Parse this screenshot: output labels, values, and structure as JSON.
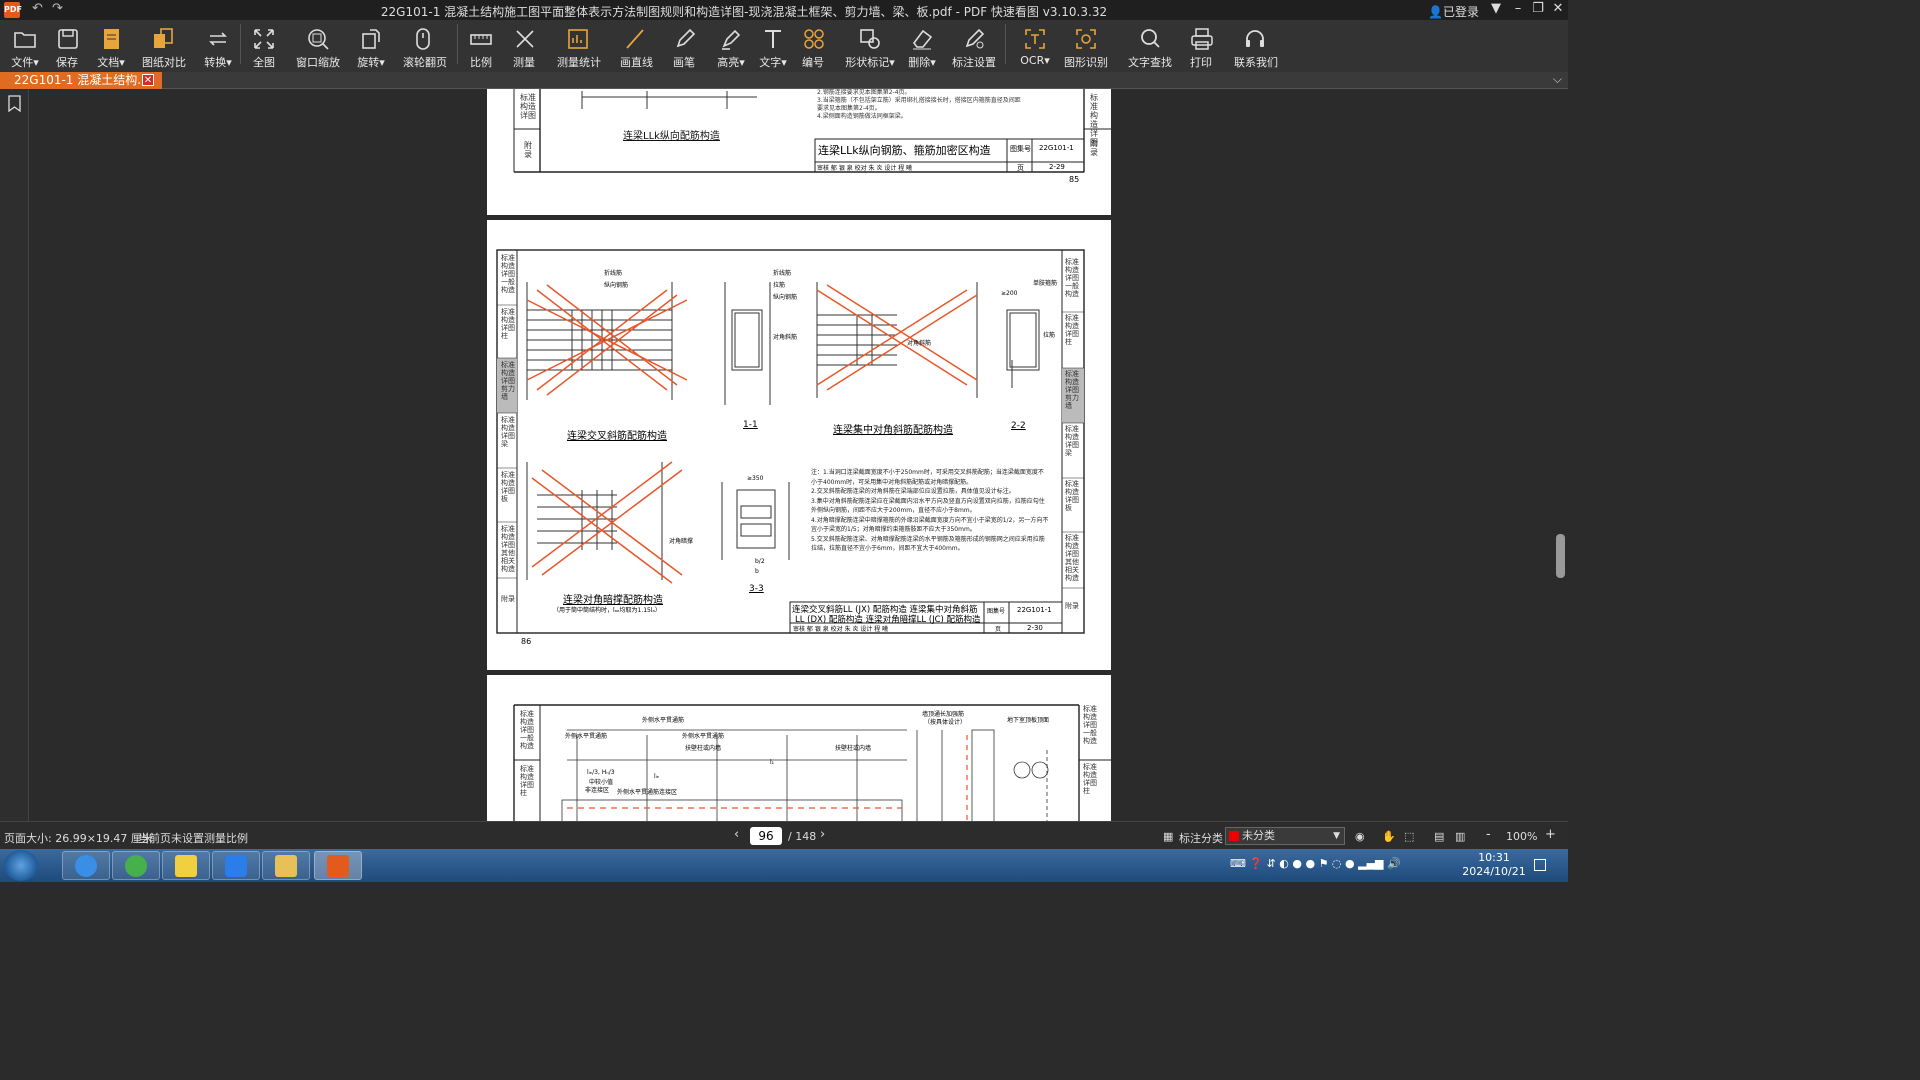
{
  "titlebar": {
    "title": "22G101-1 混凝土结构施工图平面整体表示方法制图规则和构造详图-现浇混凝土框架、剪力墙、梁、板.pdf - PDF 快速看图 v3.10.3.32",
    "app_icon_text": "PDF",
    "login": "已登录"
  },
  "toolbar": {
    "items": [
      {
        "label": "文件▾",
        "icon": "folder-icon"
      },
      {
        "label": "保存",
        "icon": "save-icon"
      },
      {
        "label": "文档▾",
        "icon": "document-icon"
      },
      {
        "label": "图纸对比",
        "icon": "compare-icon"
      },
      {
        "label": "转换▾",
        "icon": "convert-icon"
      },
      {
        "label": "全图",
        "icon": "fullview-icon"
      },
      {
        "label": "窗口缩放",
        "icon": "window-zoom-icon"
      },
      {
        "label": "旋转▾",
        "icon": "rotate-icon"
      },
      {
        "label": "滚轮翻页",
        "icon": "mouse-scroll-icon"
      },
      {
        "label": "比例",
        "icon": "scale-icon"
      },
      {
        "label": "测量",
        "icon": "measure-icon"
      },
      {
        "label": "测量统计",
        "icon": "measure-stats-icon"
      },
      {
        "label": "画直线",
        "icon": "line-icon"
      },
      {
        "label": "画笔",
        "icon": "pen-icon"
      },
      {
        "label": "高亮▾",
        "icon": "highlight-icon"
      },
      {
        "label": "文字▾",
        "icon": "text-icon"
      },
      {
        "label": "编号",
        "icon": "numbering-icon"
      },
      {
        "label": "形状标记▾",
        "icon": "shape-mark-icon"
      },
      {
        "label": "删除▾",
        "icon": "eraser-icon"
      },
      {
        "label": "标注设置",
        "icon": "annotation-settings-icon"
      },
      {
        "label": "OCR▾",
        "icon": "ocr-icon"
      },
      {
        "label": "图形识别",
        "icon": "shape-recognition-icon"
      },
      {
        "label": "文字查找",
        "icon": "search-icon"
      },
      {
        "label": "打印",
        "icon": "print-icon"
      },
      {
        "label": "联系我们",
        "icon": "headset-icon"
      }
    ]
  },
  "tab": {
    "label": "22G101-1 混凝土结构..."
  },
  "pages": {
    "top": {
      "caption": "连梁LLk纵向配筋构造",
      "title": "连梁LLk纵向钢筋、箍筋加密区构造",
      "atlas_no_label": "图集号",
      "atlas_no": "22G101-1",
      "page_label": "页",
      "page_code": "2-29",
      "page_number": "85",
      "notes": [
        "4.梁侧面构造钢筋做法同框架梁。",
        "3.当梁箍筋（不包括架立筋）采用绑扎搭接接长时，搭接区内箍筋直径及间距",
        "要求见本图集第2-4页。",
        "2.钢筋连接要求见本图集第2-4页。"
      ],
      "sidebar_labels": [
        "标准构造详图",
        "附录"
      ],
      "sign_row": "审核 郁 银 泉 校对 朱 炎 设计 程 曦"
    },
    "middle": {
      "captions": {
        "cross": "连梁交叉斜筋配筋构造",
        "sec11": "1-1",
        "concentrated": "连梁集中对角斜筋配筋构造",
        "sec22": "2-2",
        "strut": "连梁对角暗撑配筋构造",
        "strut_note": "（用于筒中筒结构时，lₐₑ均取为1.15lₐ）",
        "sec33": "3-3"
      },
      "labels": [
        "折线筋",
        "纵向钢筋",
        "对角斜筋",
        "拉筋",
        "对角暗撑",
        "单肢箍筋",
        "≥200",
        "≥350",
        "b/2",
        "b"
      ],
      "notes": [
        "注：1.当洞口连梁截面宽度不小于250mm时，可采用交叉斜筋配筋；当连梁截面宽度不小于400mm时，可采用集中对角斜筋配筋或对角暗撑配筋。",
        "2.交叉斜筋配筋连梁的对角斜筋在梁端部位应设置拉筋，具体值见设计标注。",
        "3.集中对角斜筋配筋连梁应在梁截面内沿水平方向及竖直方向设置双向拉筋，拉筋应勾住外侧纵向钢筋，间距不应大于200mm，直径不应小于8mm。",
        "4.对角暗撑配筋连梁中暗撑箍筋的外缘沿梁截面宽度方向不宜小于梁宽的1/2，另一方向不宜小于梁宽的1/5；对角暗撑约束箍筋肢距不应大于350mm。",
        "5.交叉斜筋配筋连梁、对角暗撑配筋连梁的水平钢筋及箍筋形成的钢筋网之间应采用拉筋拉结，拉筋直径不宜小于6mm，间距不宜大于400mm。"
      ],
      "title_l1": "连梁交叉斜筋LL (JX) 配筋构造  连梁集中对角斜筋",
      "title_l2": "LL (DX) 配筋构造   连梁对角暗撑LL (JC) 配筋构造",
      "atlas_no_label": "图集号",
      "atlas_no": "22G101-1",
      "page_label": "页",
      "page_code": "2-30",
      "page_number": "86",
      "sign_row": "审核 郁 银 泉 校对 朱 炎 设计 程 曦",
      "left_sidebar": [
        "标准构造详图 一般构造",
        "标准构造详图 柱",
        "标准构造详图 剪力墙",
        "标准构造详图 梁",
        "标准构造详图 板",
        "标准构造详图 其他相关构造",
        "附录"
      ],
      "right_sidebar": [
        "标准构造详图 一般构造",
        "标准构造详图 柱",
        "标准构造详图 剪力墙",
        "标准构造详图 梁",
        "标准构造详图 板",
        "标准构造详图 其他相关构造",
        "附录"
      ]
    },
    "bottom": {
      "labels": [
        "外侧水平贯通筋",
        "外侧水平贯通筋",
        "外侧水平贯通筋",
        "扶壁柱或内墙",
        "扶壁柱或内墙",
        "墙顶通长加强筋",
        "（按具体设计）",
        "地下室顶板顶面",
        "lₗₑ/3, Hₙ/3",
        "中较小值",
        "非连接区",
        "外侧水平贯通筋连接区",
        "lₗₑ",
        "l₁"
      ],
      "left_sidebar": [
        "标准构造详图 一般构造",
        "标准构造详图 柱"
      ],
      "right_sidebar": [
        "标准构造详图 一般构造",
        "标准构造详图 柱"
      ]
    }
  },
  "statusbar": {
    "page_size": "页面大小: 26.99×19.47 厘米",
    "scale_status": "当前页未设置测量比例",
    "current_page": "96",
    "total_pages": "/ 148",
    "category_label": "标注分类",
    "category_value": "未分类",
    "zoom": "100%",
    "zoom_minus": "-",
    "zoom_plus": "+"
  },
  "taskbar": {
    "time": "10:31",
    "date": "2024/10/21"
  }
}
